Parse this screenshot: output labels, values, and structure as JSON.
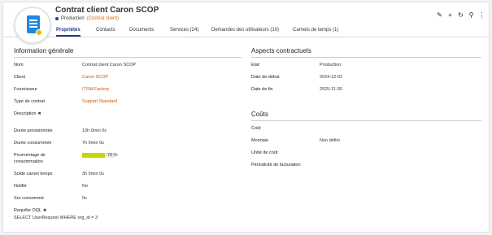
{
  "header": {
    "title": "Contrat client Caron SCOP",
    "status": "Production",
    "status_org": "(Contrat client)",
    "status_color": "#1d3e8a",
    "avatar_icon": "contract-document-icon",
    "tools": [
      "edit-icon",
      "add-icon",
      "refresh-icon",
      "search-icon",
      "more-icon"
    ]
  },
  "tabs": [
    {
      "label": "Propriétés",
      "active": true
    },
    {
      "label": "Contacts"
    },
    {
      "label": "Documents"
    },
    {
      "label": "Services (24)"
    },
    {
      "label": "Demandes des utilisateurs (10)"
    },
    {
      "label": "Carnets de temps (1)"
    }
  ],
  "general": {
    "title": "Information générale",
    "nom_label": "Nom",
    "nom": "Contrat client Caron SCOP",
    "client_label": "Client",
    "client": "Caron SCOP",
    "fournisseur_label": "Fournisseur",
    "fournisseur": "ITSM-Factory",
    "type_label": "Type de contrat",
    "type": "Support Standard",
    "description_label": "Description",
    "duree_prov_label": "Durée provisionnée",
    "duree_prov": "10h 0min 0s",
    "duree_cons_label": "Durée consommée",
    "duree_cons": "7h 0min 0s",
    "pourcentage_label_1": "Pourcentage de",
    "pourcentage_label_2": "consommation",
    "pourcentage": "70 %",
    "pourcentage_value": 0.7,
    "solde_label": "Solde carnet temps",
    "solde": "3h 0min 0s",
    "notifie_label": "Notifié",
    "notifie": "No",
    "surconso_label": "Sur consommé",
    "surconso": "0s",
    "oql_label": "Requête OQL",
    "oql": "SELECT UserRequest WHERE org_id = 3"
  },
  "contractual": {
    "title": "Aspects contractuels",
    "etat_label": "Etat",
    "etat": "Production",
    "debut_label": "Date de début",
    "debut": "2024-12-01",
    "fin_label": "Date de fin",
    "fin": "2025-11-30"
  },
  "costs": {
    "title": "Coûts",
    "cout_label": "Coût",
    "monnaie_label": "Monnaie",
    "monnaie": "Non défini",
    "unite_label": "Unité de coût",
    "periodicite_label": "Périodicité de facturation"
  }
}
